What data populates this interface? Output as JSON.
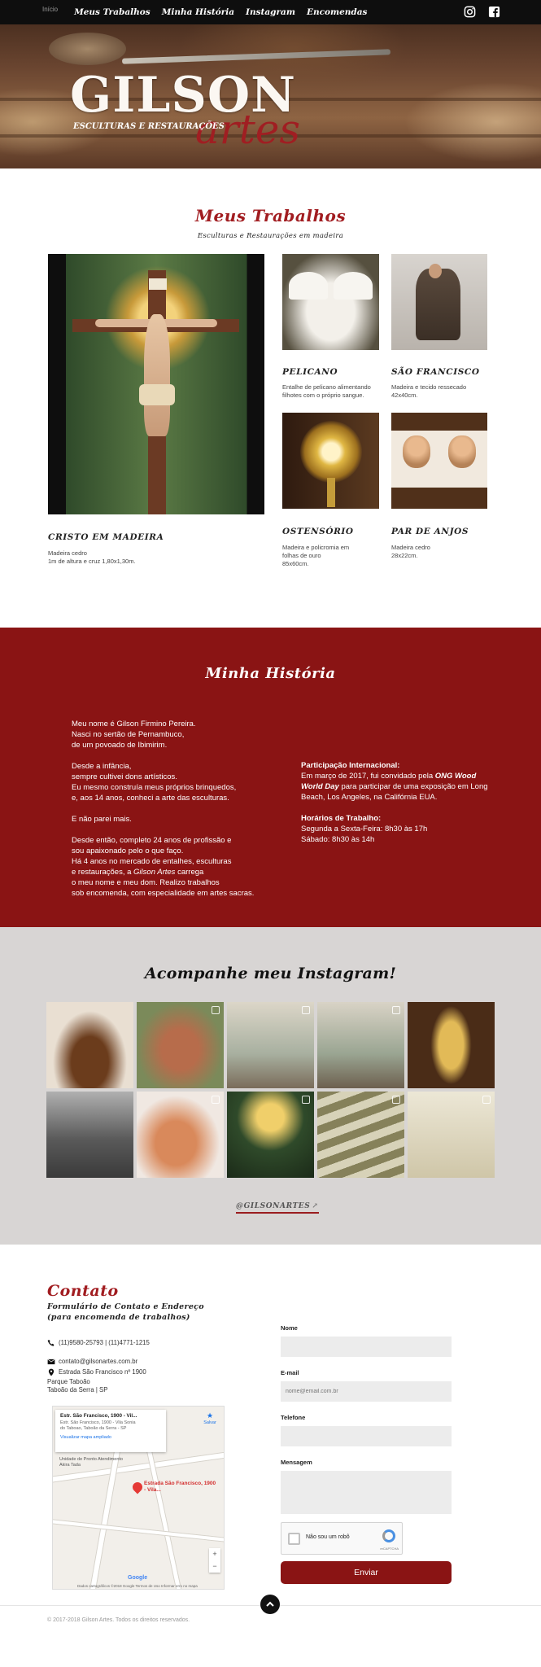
{
  "nav": {
    "home": "Início",
    "links": [
      "Meus Trabalhos",
      "Minha História",
      "Instagram",
      "Encomendas"
    ],
    "icons": [
      "instagram-icon",
      "facebook-icon"
    ]
  },
  "hero": {
    "logo_main": "GILSON",
    "logo_script": "artes",
    "logo_sub": "ESCULTURAS E RESTAURAÇÕES"
  },
  "trabalhos": {
    "title": "Meus Trabalhos",
    "subtitle": "Esculturas e Restaurações em madeira",
    "items": [
      {
        "title": "CRISTO EM MADEIRA",
        "desc1": "Madeira cedro",
        "desc2": "1m de altura e cruz 1,80x1,30m."
      },
      {
        "title": "PELICANO",
        "desc1": "Entalhe de pelicano alimentando",
        "desc2": "filhotes com o próprio sangue."
      },
      {
        "title": "SÃO FRANCISCO",
        "desc1": "Madeira e tecido ressecado",
        "desc2": "42x40cm."
      },
      {
        "title": "OSTENSÓRIO",
        "desc1": "Madeira e policromia em",
        "desc2": "folhas de ouro",
        "desc3": "85x60cm."
      },
      {
        "title": "PAR DE ANJOS",
        "desc1": "Madeira cedro",
        "desc2": "28x22cm."
      }
    ]
  },
  "historia": {
    "title": "Minha História",
    "left": [
      "Meu nome é Gilson Firmino Pereira.",
      "Nasci no sertão de Pernambuco,",
      "de um povoado de Ibimirim.",
      "Desde a infância,",
      "sempre cultivei dons artísticos.",
      "Eu mesmo construía meus próprios brinquedos,",
      "e, aos 14 anos, conheci a arte das esculturas.",
      "E não parei mais.",
      "Desde então, completo 24 anos de profissão e",
      "sou apaixonado pelo o que faço.",
      "Há 4 anos no mercado de entalhes, esculturas",
      "e restaurações, a ",
      "Gilson Artes",
      " carrega",
      "o meu nome e meu dom. Realizo trabalhos",
      "sob encomenda, com especialidade em artes sacras."
    ],
    "right": {
      "intl_label": "Participação Internacional:",
      "intl_text_a": "Em março de 2017, fui convidado pela ",
      "intl_em": "ONG Wood World Day",
      "intl_text_b": " para participar de uma exposição em Long Beach, Los Angeles, na Califórnia EUA.",
      "hours_label": "Horários de Trabalho:",
      "hours_1": "Segunda a Sexta-Feira: 8h30 às 17h",
      "hours_2": "Sábado: 8h30 às 14h"
    }
  },
  "instagram": {
    "title": "Acompanhe meu Instagram!",
    "handle": "@GILSONARTES",
    "tiles": 10
  },
  "contato": {
    "title": "Contato",
    "subtitle1": "Formulário de Contato e Endereço",
    "subtitle2": "(para encomenda de trabalhos)",
    "phone": "(11)9580-25793 | (11)4771-1215",
    "email": "contato@gilsonartes.com.br",
    "address1": "Estrada São Francisco nº 1900",
    "address2": "Parque Taboão",
    "address3": "Taboão da Serra | SP",
    "map": {
      "card_title": "Estr. São Francisco, 1900 - Vil...",
      "card_desc": "Estr. São Francisco, 1900 - Vila Sonia do Taboao, Taboão da Serra - SP",
      "card_link": "Visualizar mapa ampliado",
      "save": "Salvar",
      "pin_label": "Estrada São Francisco, 1900 - Vila...",
      "poi": "Unidade de Pronto Atendimento Akira Tada",
      "google": "Google",
      "footer": "Dados cartográficos ©2018 Google   Termos de Uso   Informar erro no mapa"
    },
    "form": {
      "name_label": "Nome",
      "email_label": "E-mail",
      "email_placeholder": "nome@email.com.br",
      "phone_label": "Telefone",
      "message_label": "Mensagem",
      "captcha": "Não sou um robô",
      "captcha_brand": "reCAPTCHA",
      "submit": "Enviar"
    }
  },
  "footer": {
    "copyright": "© 2017-2018 Gilson Artes. Todos os direitos reservados."
  }
}
